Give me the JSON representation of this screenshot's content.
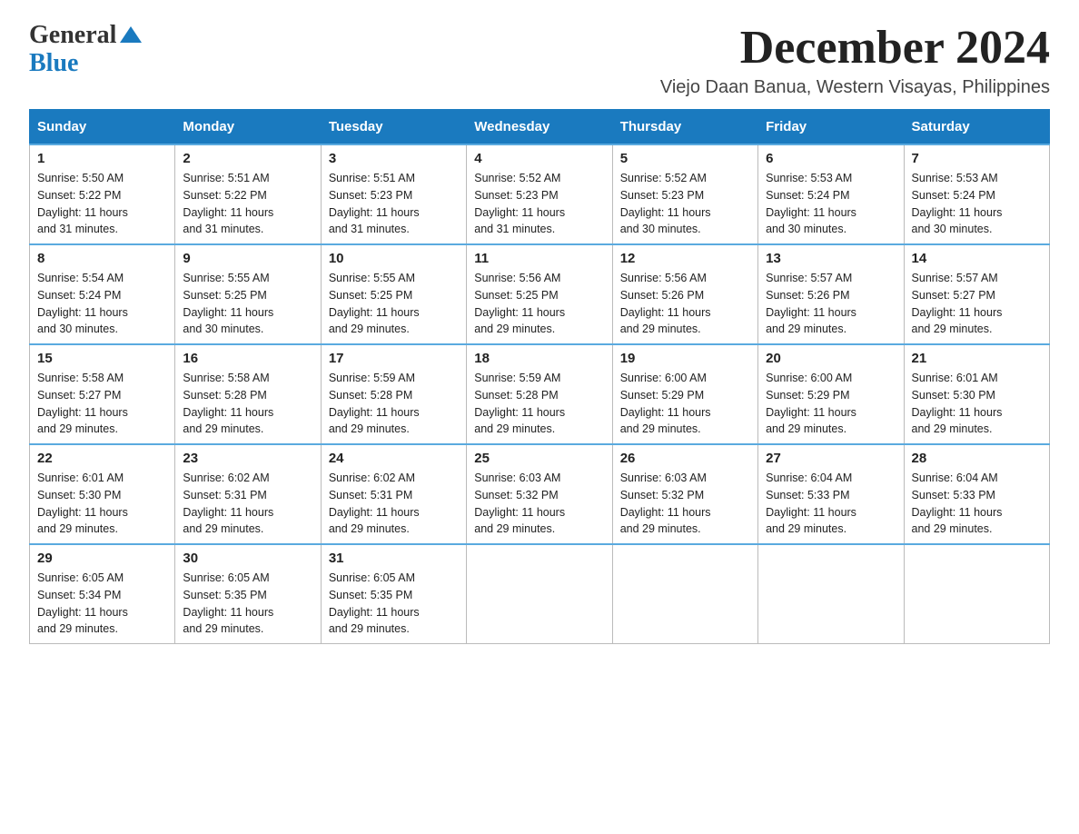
{
  "logo": {
    "general": "General",
    "blue": "Blue",
    "tagline": ""
  },
  "title": "December 2024",
  "subtitle": "Viejo Daan Banua, Western Visayas, Philippines",
  "weekdays": [
    "Sunday",
    "Monday",
    "Tuesday",
    "Wednesday",
    "Thursday",
    "Friday",
    "Saturday"
  ],
  "weeks": [
    [
      {
        "day": "1",
        "sunrise": "5:50 AM",
        "sunset": "5:22 PM",
        "daylight": "11 hours and 31 minutes."
      },
      {
        "day": "2",
        "sunrise": "5:51 AM",
        "sunset": "5:22 PM",
        "daylight": "11 hours and 31 minutes."
      },
      {
        "day": "3",
        "sunrise": "5:51 AM",
        "sunset": "5:23 PM",
        "daylight": "11 hours and 31 minutes."
      },
      {
        "day": "4",
        "sunrise": "5:52 AM",
        "sunset": "5:23 PM",
        "daylight": "11 hours and 31 minutes."
      },
      {
        "day": "5",
        "sunrise": "5:52 AM",
        "sunset": "5:23 PM",
        "daylight": "11 hours and 30 minutes."
      },
      {
        "day": "6",
        "sunrise": "5:53 AM",
        "sunset": "5:24 PM",
        "daylight": "11 hours and 30 minutes."
      },
      {
        "day": "7",
        "sunrise": "5:53 AM",
        "sunset": "5:24 PM",
        "daylight": "11 hours and 30 minutes."
      }
    ],
    [
      {
        "day": "8",
        "sunrise": "5:54 AM",
        "sunset": "5:24 PM",
        "daylight": "11 hours and 30 minutes."
      },
      {
        "day": "9",
        "sunrise": "5:55 AM",
        "sunset": "5:25 PM",
        "daylight": "11 hours and 30 minutes."
      },
      {
        "day": "10",
        "sunrise": "5:55 AM",
        "sunset": "5:25 PM",
        "daylight": "11 hours and 29 minutes."
      },
      {
        "day": "11",
        "sunrise": "5:56 AM",
        "sunset": "5:25 PM",
        "daylight": "11 hours and 29 minutes."
      },
      {
        "day": "12",
        "sunrise": "5:56 AM",
        "sunset": "5:26 PM",
        "daylight": "11 hours and 29 minutes."
      },
      {
        "day": "13",
        "sunrise": "5:57 AM",
        "sunset": "5:26 PM",
        "daylight": "11 hours and 29 minutes."
      },
      {
        "day": "14",
        "sunrise": "5:57 AM",
        "sunset": "5:27 PM",
        "daylight": "11 hours and 29 minutes."
      }
    ],
    [
      {
        "day": "15",
        "sunrise": "5:58 AM",
        "sunset": "5:27 PM",
        "daylight": "11 hours and 29 minutes."
      },
      {
        "day": "16",
        "sunrise": "5:58 AM",
        "sunset": "5:28 PM",
        "daylight": "11 hours and 29 minutes."
      },
      {
        "day": "17",
        "sunrise": "5:59 AM",
        "sunset": "5:28 PM",
        "daylight": "11 hours and 29 minutes."
      },
      {
        "day": "18",
        "sunrise": "5:59 AM",
        "sunset": "5:28 PM",
        "daylight": "11 hours and 29 minutes."
      },
      {
        "day": "19",
        "sunrise": "6:00 AM",
        "sunset": "5:29 PM",
        "daylight": "11 hours and 29 minutes."
      },
      {
        "day": "20",
        "sunrise": "6:00 AM",
        "sunset": "5:29 PM",
        "daylight": "11 hours and 29 minutes."
      },
      {
        "day": "21",
        "sunrise": "6:01 AM",
        "sunset": "5:30 PM",
        "daylight": "11 hours and 29 minutes."
      }
    ],
    [
      {
        "day": "22",
        "sunrise": "6:01 AM",
        "sunset": "5:30 PM",
        "daylight": "11 hours and 29 minutes."
      },
      {
        "day": "23",
        "sunrise": "6:02 AM",
        "sunset": "5:31 PM",
        "daylight": "11 hours and 29 minutes."
      },
      {
        "day": "24",
        "sunrise": "6:02 AM",
        "sunset": "5:31 PM",
        "daylight": "11 hours and 29 minutes."
      },
      {
        "day": "25",
        "sunrise": "6:03 AM",
        "sunset": "5:32 PM",
        "daylight": "11 hours and 29 minutes."
      },
      {
        "day": "26",
        "sunrise": "6:03 AM",
        "sunset": "5:32 PM",
        "daylight": "11 hours and 29 minutes."
      },
      {
        "day": "27",
        "sunrise": "6:04 AM",
        "sunset": "5:33 PM",
        "daylight": "11 hours and 29 minutes."
      },
      {
        "day": "28",
        "sunrise": "6:04 AM",
        "sunset": "5:33 PM",
        "daylight": "11 hours and 29 minutes."
      }
    ],
    [
      {
        "day": "29",
        "sunrise": "6:05 AM",
        "sunset": "5:34 PM",
        "daylight": "11 hours and 29 minutes."
      },
      {
        "day": "30",
        "sunrise": "6:05 AM",
        "sunset": "5:35 PM",
        "daylight": "11 hours and 29 minutes."
      },
      {
        "day": "31",
        "sunrise": "6:05 AM",
        "sunset": "5:35 PM",
        "daylight": "11 hours and 29 minutes."
      },
      null,
      null,
      null,
      null
    ]
  ],
  "labels": {
    "sunrise": "Sunrise:",
    "sunset": "Sunset:",
    "daylight": "Daylight:"
  }
}
